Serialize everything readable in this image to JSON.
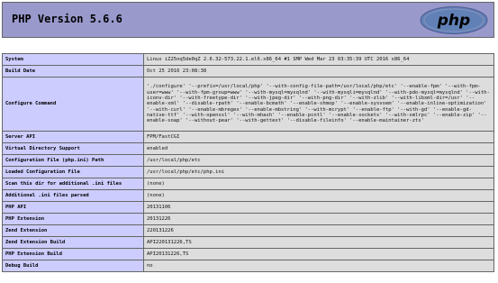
{
  "header": {
    "title": "PHP Version 5.6.6",
    "logo_text": "php",
    "logo_color": "#6181b6"
  },
  "rows": [
    {
      "label": "System",
      "value": "Linux iZ25nq5de0qZ 2.6.32-573.22.1.el6.x86_64 #1 SMP Wed Mar 23 03:35:39 UTC 2016 x86_64"
    },
    {
      "label": "Build Date",
      "value": "Oct 25 2016 23:08:38"
    },
    {
      "label": "Configure Command",
      "value": "'./configure' '--prefix=/usr/local/php' '--with-config-file-path=/usr/local/php/etc' '--enable-fpm' '--with-fpm-user=www' '--with-fpm-group=www' '--with-mysql=mysqlnd' '--with-mysqli=mysqlnd' '--with-pdo-mysql=mysqlnd' '--with-iconv-dir' '--with-freetype-dir' '--with-jpeg-dir' '--with-png-dir' '--with-zlib' '--with-libxml-dir=/usr' '--enable-xml' '--disable-rpath' '--enable-bcmath' '--enable-shmop' '--enable-sysvsem' '--enable-inline-optimization' '--with-curl' '--enable-mbregex' '--enable-mbstring' '--with-mcrypt' '--enable-ftp' '--with-gd' '--enable-gd-native-ttf' '--with-openssl' '--with-mhash' '--enable-pcntl' '--enable-sockets' '--with-xmlrpc' '--enable-zip' '--enable-soap' '--without-pear' '--with-gettext' '--disable-fileinfo' '--enable-maintainer-zts'"
    },
    {
      "label": "Server API",
      "value": "FPM/FastCGI"
    },
    {
      "label": "Virtual Directory Support",
      "value": "enabled"
    },
    {
      "label": "Configuration File (php.ini) Path",
      "value": "/usr/local/php/etc"
    },
    {
      "label": "Loaded Configuration File",
      "value": "/usr/local/php/etc/php.ini"
    },
    {
      "label": "Scan this dir for additional .ini files",
      "value": "(none)"
    },
    {
      "label": "Additional .ini files parsed",
      "value": "(none)"
    },
    {
      "label": "PHP API",
      "value": "20131106"
    },
    {
      "label": "PHP Extension",
      "value": "20131226"
    },
    {
      "label": "Zend Extension",
      "value": "220131226"
    },
    {
      "label": "Zend Extension Build",
      "value": "API220131226,TS"
    },
    {
      "label": "PHP Extension Build",
      "value": "API20131226,TS"
    },
    {
      "label": "Debug Build",
      "value": "no"
    }
  ]
}
